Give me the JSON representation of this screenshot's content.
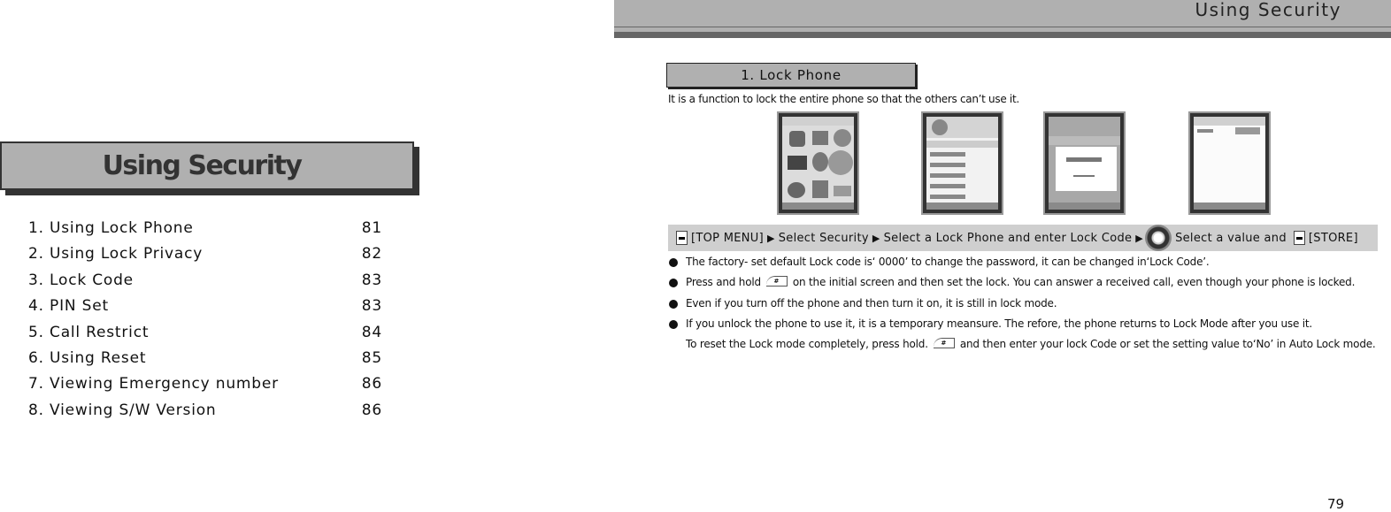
{
  "left_page": {
    "title": "Using Security",
    "toc": [
      {
        "label": "1. Using Lock Phone",
        "page": "81"
      },
      {
        "label": "2. Using Lock Privacy",
        "page": "82"
      },
      {
        "label": "3. Lock Code",
        "page": "83"
      },
      {
        "label": "4. PIN Set",
        "page": "83"
      },
      {
        "label": "5. Call Restrict",
        "page": "84"
      },
      {
        "label": "6. Using Reset",
        "page": "85"
      },
      {
        "label": "7. Viewing Emergency number",
        "page": "86"
      },
      {
        "label": "8. Viewing S/W Version",
        "page": "86"
      }
    ]
  },
  "right_page": {
    "header_title": "Using Security",
    "section_title": "1. Lock Phone",
    "intro": "It is a function to lock the entire phone so that the others can’t use it.",
    "screenshots": [
      {
        "icon": "phone-screen-menu-grid"
      },
      {
        "icon": "phone-screen-security-list"
      },
      {
        "icon": "phone-screen-lock-code-dialog"
      },
      {
        "icon": "phone-screen-lock-setting"
      }
    ],
    "nav_path": {
      "step1": "[TOP MENU]",
      "step2": "Select Security",
      "step3": "Select a Lock Phone and enter Lock Code",
      "step4": "Select a value and",
      "step5": "[STORE]"
    },
    "bullets": [
      {
        "pre": "The factory- set default Lock code is‘ 0000’ to change the password, it can be changed in‘Lock Code’.",
        "key": "",
        "post": ""
      },
      {
        "pre": "Press and hold",
        "key": "#",
        "post": "on the initial screen and then set the lock. You can answer a received call, even though your phone is locked."
      },
      {
        "pre": "Even if you turn off the phone and then turn it on, it is still in lock mode.",
        "key": "",
        "post": ""
      },
      {
        "pre": "If you unlock the phone to use it, it is a temporary meansure. The refore, the phone returns to Lock Mode after you use it.",
        "key": "",
        "post": ""
      }
    ],
    "continuation": {
      "pre": "To reset the Lock mode completely, press hold.",
      "key": "#",
      "post": "and then enter your lock Code or set the setting value to‘No’ in Auto Lock mode."
    },
    "page_number": "79"
  }
}
